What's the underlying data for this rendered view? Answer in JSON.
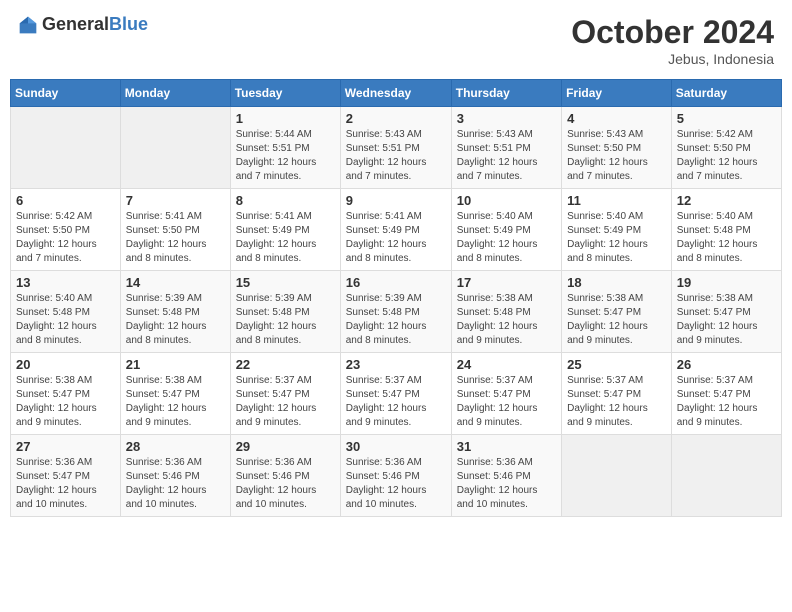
{
  "header": {
    "logo_general": "General",
    "logo_blue": "Blue",
    "month_title": "October 2024",
    "location": "Jebus, Indonesia"
  },
  "weekdays": [
    "Sunday",
    "Monday",
    "Tuesday",
    "Wednesday",
    "Thursday",
    "Friday",
    "Saturday"
  ],
  "weeks": [
    [
      {
        "day": "",
        "detail": ""
      },
      {
        "day": "",
        "detail": ""
      },
      {
        "day": "1",
        "detail": "Sunrise: 5:44 AM\nSunset: 5:51 PM\nDaylight: 12 hours and 7 minutes."
      },
      {
        "day": "2",
        "detail": "Sunrise: 5:43 AM\nSunset: 5:51 PM\nDaylight: 12 hours and 7 minutes."
      },
      {
        "day": "3",
        "detail": "Sunrise: 5:43 AM\nSunset: 5:51 PM\nDaylight: 12 hours and 7 minutes."
      },
      {
        "day": "4",
        "detail": "Sunrise: 5:43 AM\nSunset: 5:50 PM\nDaylight: 12 hours and 7 minutes."
      },
      {
        "day": "5",
        "detail": "Sunrise: 5:42 AM\nSunset: 5:50 PM\nDaylight: 12 hours and 7 minutes."
      }
    ],
    [
      {
        "day": "6",
        "detail": "Sunrise: 5:42 AM\nSunset: 5:50 PM\nDaylight: 12 hours and 7 minutes."
      },
      {
        "day": "7",
        "detail": "Sunrise: 5:41 AM\nSunset: 5:50 PM\nDaylight: 12 hours and 8 minutes."
      },
      {
        "day": "8",
        "detail": "Sunrise: 5:41 AM\nSunset: 5:49 PM\nDaylight: 12 hours and 8 minutes."
      },
      {
        "day": "9",
        "detail": "Sunrise: 5:41 AM\nSunset: 5:49 PM\nDaylight: 12 hours and 8 minutes."
      },
      {
        "day": "10",
        "detail": "Sunrise: 5:40 AM\nSunset: 5:49 PM\nDaylight: 12 hours and 8 minutes."
      },
      {
        "day": "11",
        "detail": "Sunrise: 5:40 AM\nSunset: 5:49 PM\nDaylight: 12 hours and 8 minutes."
      },
      {
        "day": "12",
        "detail": "Sunrise: 5:40 AM\nSunset: 5:48 PM\nDaylight: 12 hours and 8 minutes."
      }
    ],
    [
      {
        "day": "13",
        "detail": "Sunrise: 5:40 AM\nSunset: 5:48 PM\nDaylight: 12 hours and 8 minutes."
      },
      {
        "day": "14",
        "detail": "Sunrise: 5:39 AM\nSunset: 5:48 PM\nDaylight: 12 hours and 8 minutes."
      },
      {
        "day": "15",
        "detail": "Sunrise: 5:39 AM\nSunset: 5:48 PM\nDaylight: 12 hours and 8 minutes."
      },
      {
        "day": "16",
        "detail": "Sunrise: 5:39 AM\nSunset: 5:48 PM\nDaylight: 12 hours and 8 minutes."
      },
      {
        "day": "17",
        "detail": "Sunrise: 5:38 AM\nSunset: 5:48 PM\nDaylight: 12 hours and 9 minutes."
      },
      {
        "day": "18",
        "detail": "Sunrise: 5:38 AM\nSunset: 5:47 PM\nDaylight: 12 hours and 9 minutes."
      },
      {
        "day": "19",
        "detail": "Sunrise: 5:38 AM\nSunset: 5:47 PM\nDaylight: 12 hours and 9 minutes."
      }
    ],
    [
      {
        "day": "20",
        "detail": "Sunrise: 5:38 AM\nSunset: 5:47 PM\nDaylight: 12 hours and 9 minutes."
      },
      {
        "day": "21",
        "detail": "Sunrise: 5:38 AM\nSunset: 5:47 PM\nDaylight: 12 hours and 9 minutes."
      },
      {
        "day": "22",
        "detail": "Sunrise: 5:37 AM\nSunset: 5:47 PM\nDaylight: 12 hours and 9 minutes."
      },
      {
        "day": "23",
        "detail": "Sunrise: 5:37 AM\nSunset: 5:47 PM\nDaylight: 12 hours and 9 minutes."
      },
      {
        "day": "24",
        "detail": "Sunrise: 5:37 AM\nSunset: 5:47 PM\nDaylight: 12 hours and 9 minutes."
      },
      {
        "day": "25",
        "detail": "Sunrise: 5:37 AM\nSunset: 5:47 PM\nDaylight: 12 hours and 9 minutes."
      },
      {
        "day": "26",
        "detail": "Sunrise: 5:37 AM\nSunset: 5:47 PM\nDaylight: 12 hours and 9 minutes."
      }
    ],
    [
      {
        "day": "27",
        "detail": "Sunrise: 5:36 AM\nSunset: 5:47 PM\nDaylight: 12 hours and 10 minutes."
      },
      {
        "day": "28",
        "detail": "Sunrise: 5:36 AM\nSunset: 5:46 PM\nDaylight: 12 hours and 10 minutes."
      },
      {
        "day": "29",
        "detail": "Sunrise: 5:36 AM\nSunset: 5:46 PM\nDaylight: 12 hours and 10 minutes."
      },
      {
        "day": "30",
        "detail": "Sunrise: 5:36 AM\nSunset: 5:46 PM\nDaylight: 12 hours and 10 minutes."
      },
      {
        "day": "31",
        "detail": "Sunrise: 5:36 AM\nSunset: 5:46 PM\nDaylight: 12 hours and 10 minutes."
      },
      {
        "day": "",
        "detail": ""
      },
      {
        "day": "",
        "detail": ""
      }
    ]
  ]
}
